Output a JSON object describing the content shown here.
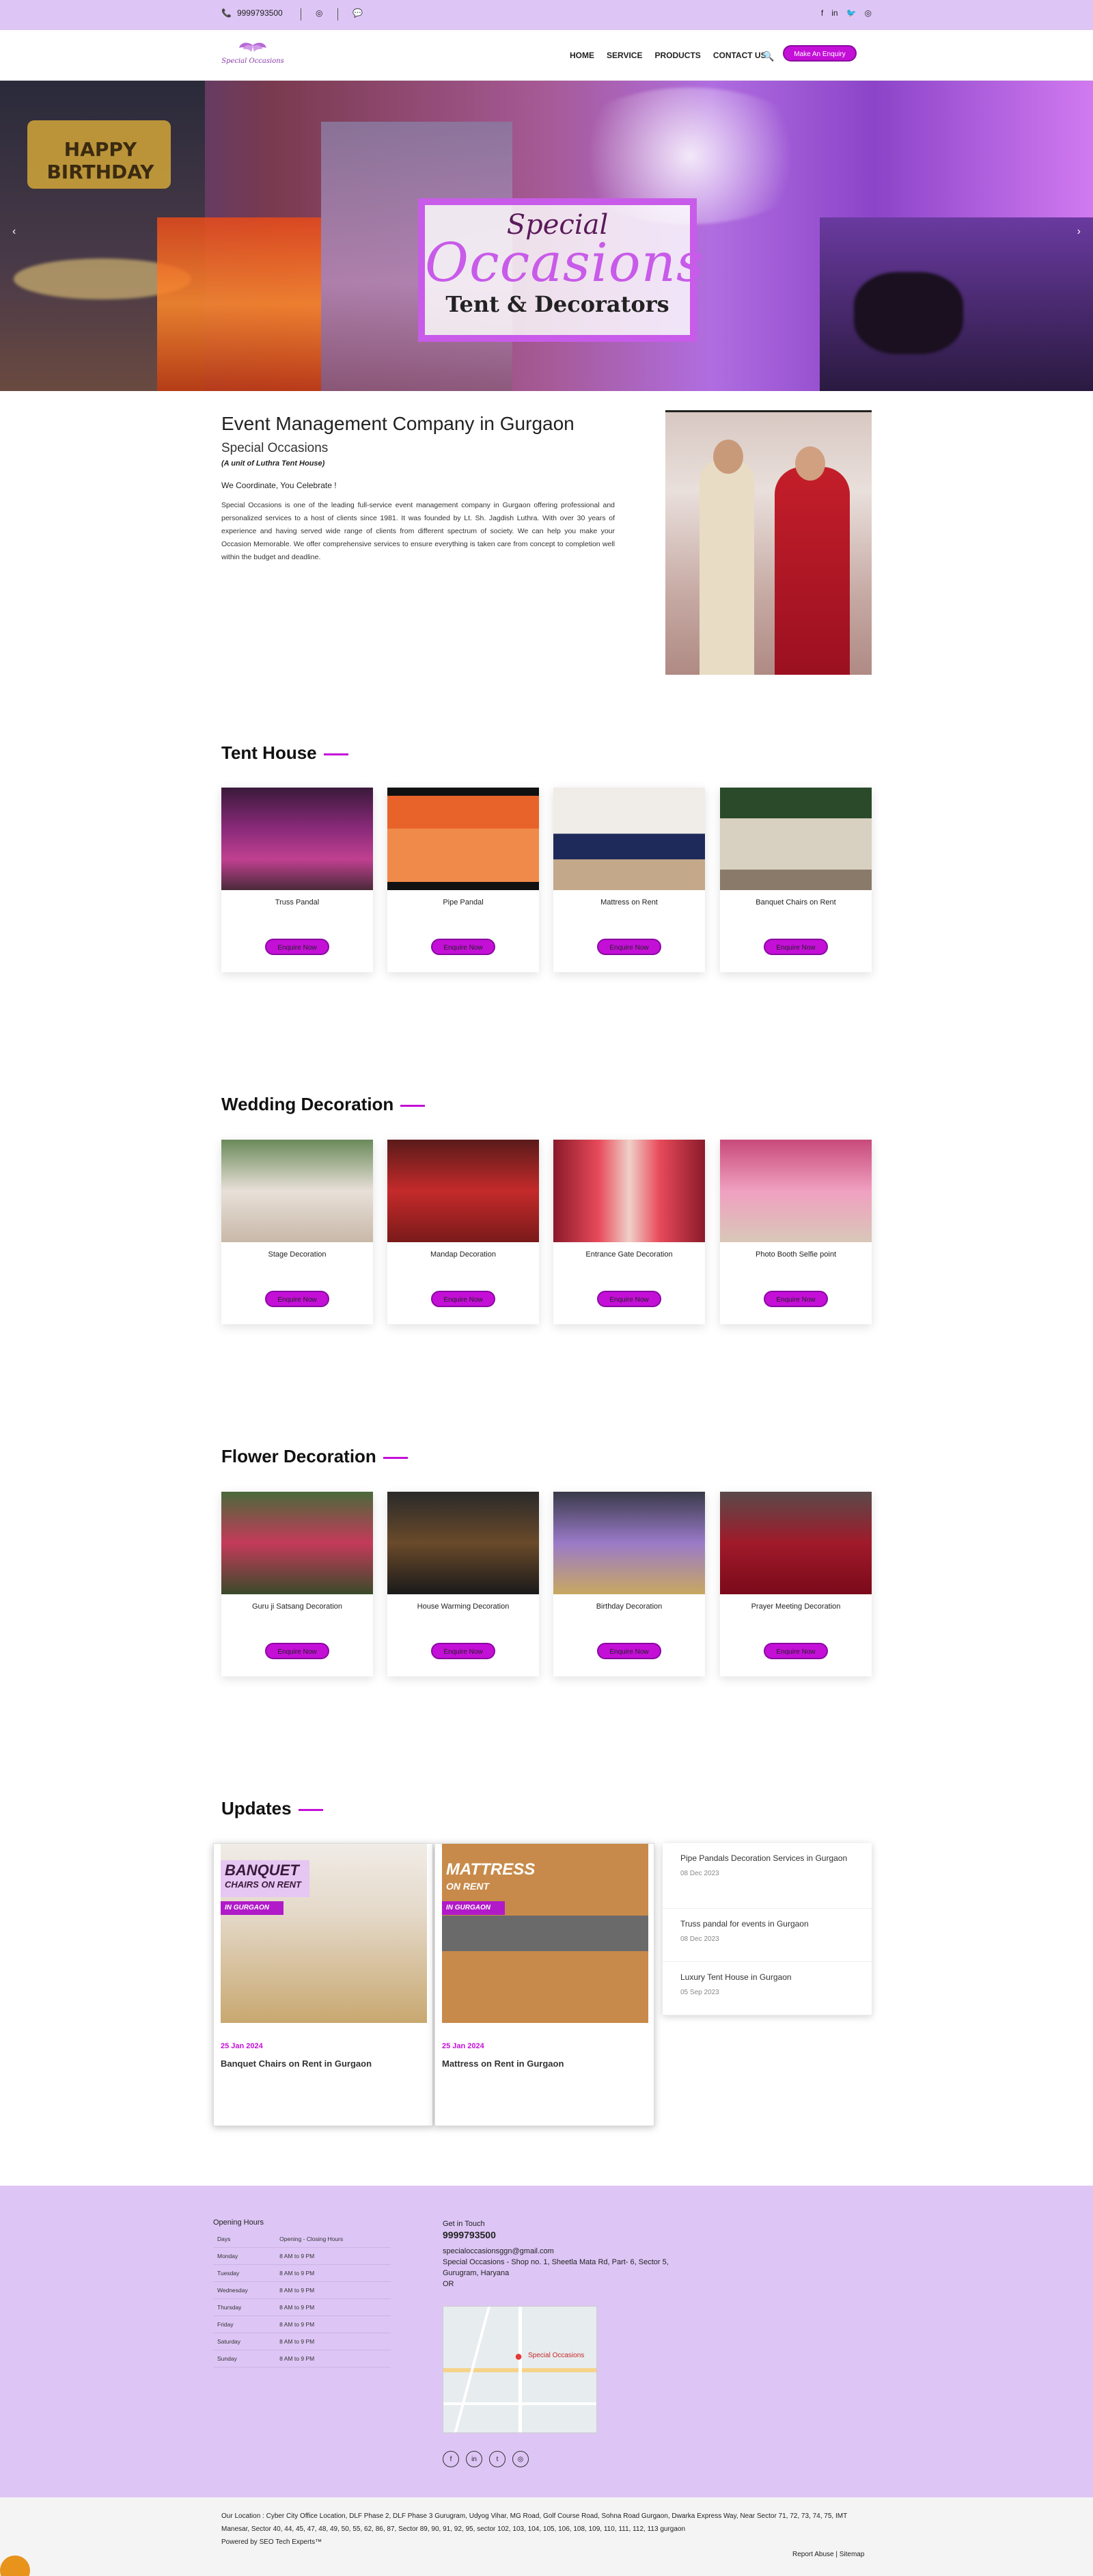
{
  "topbar": {
    "phone": "9999793500",
    "social_icons": [
      "facebook-icon",
      "linkedin-icon",
      "twitter-icon",
      "instagram-icon"
    ]
  },
  "header": {
    "logo_text": "Special Occasions",
    "nav": [
      "HOME",
      "SERVICE",
      "PRODUCTS",
      "CONTACT US"
    ],
    "enquiry_button": "Make An Enquiry"
  },
  "hero": {
    "line1": "Special",
    "line2": "Occasions",
    "line3": "Tent & Decorators",
    "balloon_text": "HAPPY BIRTHDAY"
  },
  "about": {
    "heading": "Event Management Company in Gurgaon",
    "subheading": "Special Occasions",
    "unit": "(A unit of Luthra Tent House)",
    "tagline": "We Coordinate, You Celebrate !",
    "paragraph": "Special Occasions is one of the leading full-service event management company in Gurgaon offering professional and personalized services to a host of clients since 1981. It was founded by Lt. Sh. Jagdish Luthra. With over 30 years of experience and having served wide range of clients from different spectrum of society. We can help you make your Occasion Memorable. We offer comprehensive services to ensure everything is taken care from concept to completion well within the budget and deadline."
  },
  "sections": [
    {
      "title": "Tent House",
      "items": [
        {
          "title": "Truss Pandal",
          "button": "Enquire Now"
        },
        {
          "title": "Pipe Pandal",
          "button": "Enquire Now"
        },
        {
          "title": "Mattress on Rent",
          "button": "Enquire Now"
        },
        {
          "title": "Banquet Chairs on Rent",
          "button": "Enquire Now"
        }
      ]
    },
    {
      "title": "Wedding Decoration",
      "items": [
        {
          "title": "Stage Decoration",
          "button": "Enquire Now"
        },
        {
          "title": "Mandap Decoration",
          "button": "Enquire Now"
        },
        {
          "title": "Entrance Gate Decoration",
          "button": "Enquire Now"
        },
        {
          "title": "Photo Booth Selfie point",
          "button": "Enquire Now"
        }
      ]
    },
    {
      "title": "Flower Decoration",
      "items": [
        {
          "title": "Guru ji Satsang Decoration",
          "button": "Enquire Now"
        },
        {
          "title": "House Warming Decoration",
          "button": "Enquire Now"
        },
        {
          "title": "Birthday Decoration",
          "button": "Enquire Now"
        },
        {
          "title": "Prayer Meeting Decoration",
          "button": "Enquire Now"
        }
      ]
    }
  ],
  "updates": {
    "title": "Updates",
    "cards": [
      {
        "date": "25 Jan 2024",
        "title": "Banquet Chairs on Rent in Gurgaon",
        "img_line1": "BANQUET",
        "img_line2": "CHAIRS ON RENT",
        "img_line3": "IN GURGAON"
      },
      {
        "date": "25 Jan 2024",
        "title": "Mattress on Rent in Gurgaon",
        "img_line1": "MATTRESS",
        "img_line2": "ON RENT",
        "img_line3": "IN GURGAON"
      }
    ],
    "list": [
      {
        "title": "Pipe Pandals Decoration Services in Gurgaon",
        "date": "08 Dec 2023"
      },
      {
        "title": "Truss pandal for events in Gurgaon",
        "date": "08 Dec 2023"
      },
      {
        "title": "Luxury Tent House in Gurgaon",
        "date": "05 Sep 2023"
      }
    ]
  },
  "footer": {
    "opening_hours_title": "Opening Hours",
    "hours_header": [
      "Days",
      "Opening - Closing Hours"
    ],
    "hours": [
      [
        "Monday",
        "8 AM to 9 PM"
      ],
      [
        "Tuesday",
        "8 AM to 9 PM"
      ],
      [
        "Wednesday",
        "8 AM to 9 PM"
      ],
      [
        "Thursday",
        "8 AM to 9 PM"
      ],
      [
        "Friday",
        "8 AM to 9 PM"
      ],
      [
        "Saturday",
        "8 AM to 9 PM"
      ],
      [
        "Sunday",
        "8 AM to 9 PM"
      ]
    ],
    "get_in_touch": "Get in Touch",
    "phone": "9999793500",
    "email": "specialoccasionsggn@gmail.com",
    "address": "Special Occasions - Shop no. 1, Sheetla Mata Rd, Part- 6, Sector 5, Gurugram, Haryana",
    "or": "OR",
    "map_label": "Special Occasions",
    "location_text": "Our Location : Cyber City Office Location, DLF Phase 2, DLF Phase 3 Gurugram, Udyog Vihar, MG Road, Golf Course Road, Sohna Road Gurgaon, Dwarka Express Way, Near Sector 71, 72, 73, 74, 75, IMT Manesar, Sector 40, 44, 45, 47, 48, 49, 50, 55, 62, 86, 87, Sector 89, 90, 91, 92, 95, sector 102, 103, 104, 105, 106, 108, 109, 110, 111, 112, 113 gurgaon",
    "powered": "Powered by SEO Tech Experts™",
    "report": "Report Abuse | Sitemap"
  }
}
